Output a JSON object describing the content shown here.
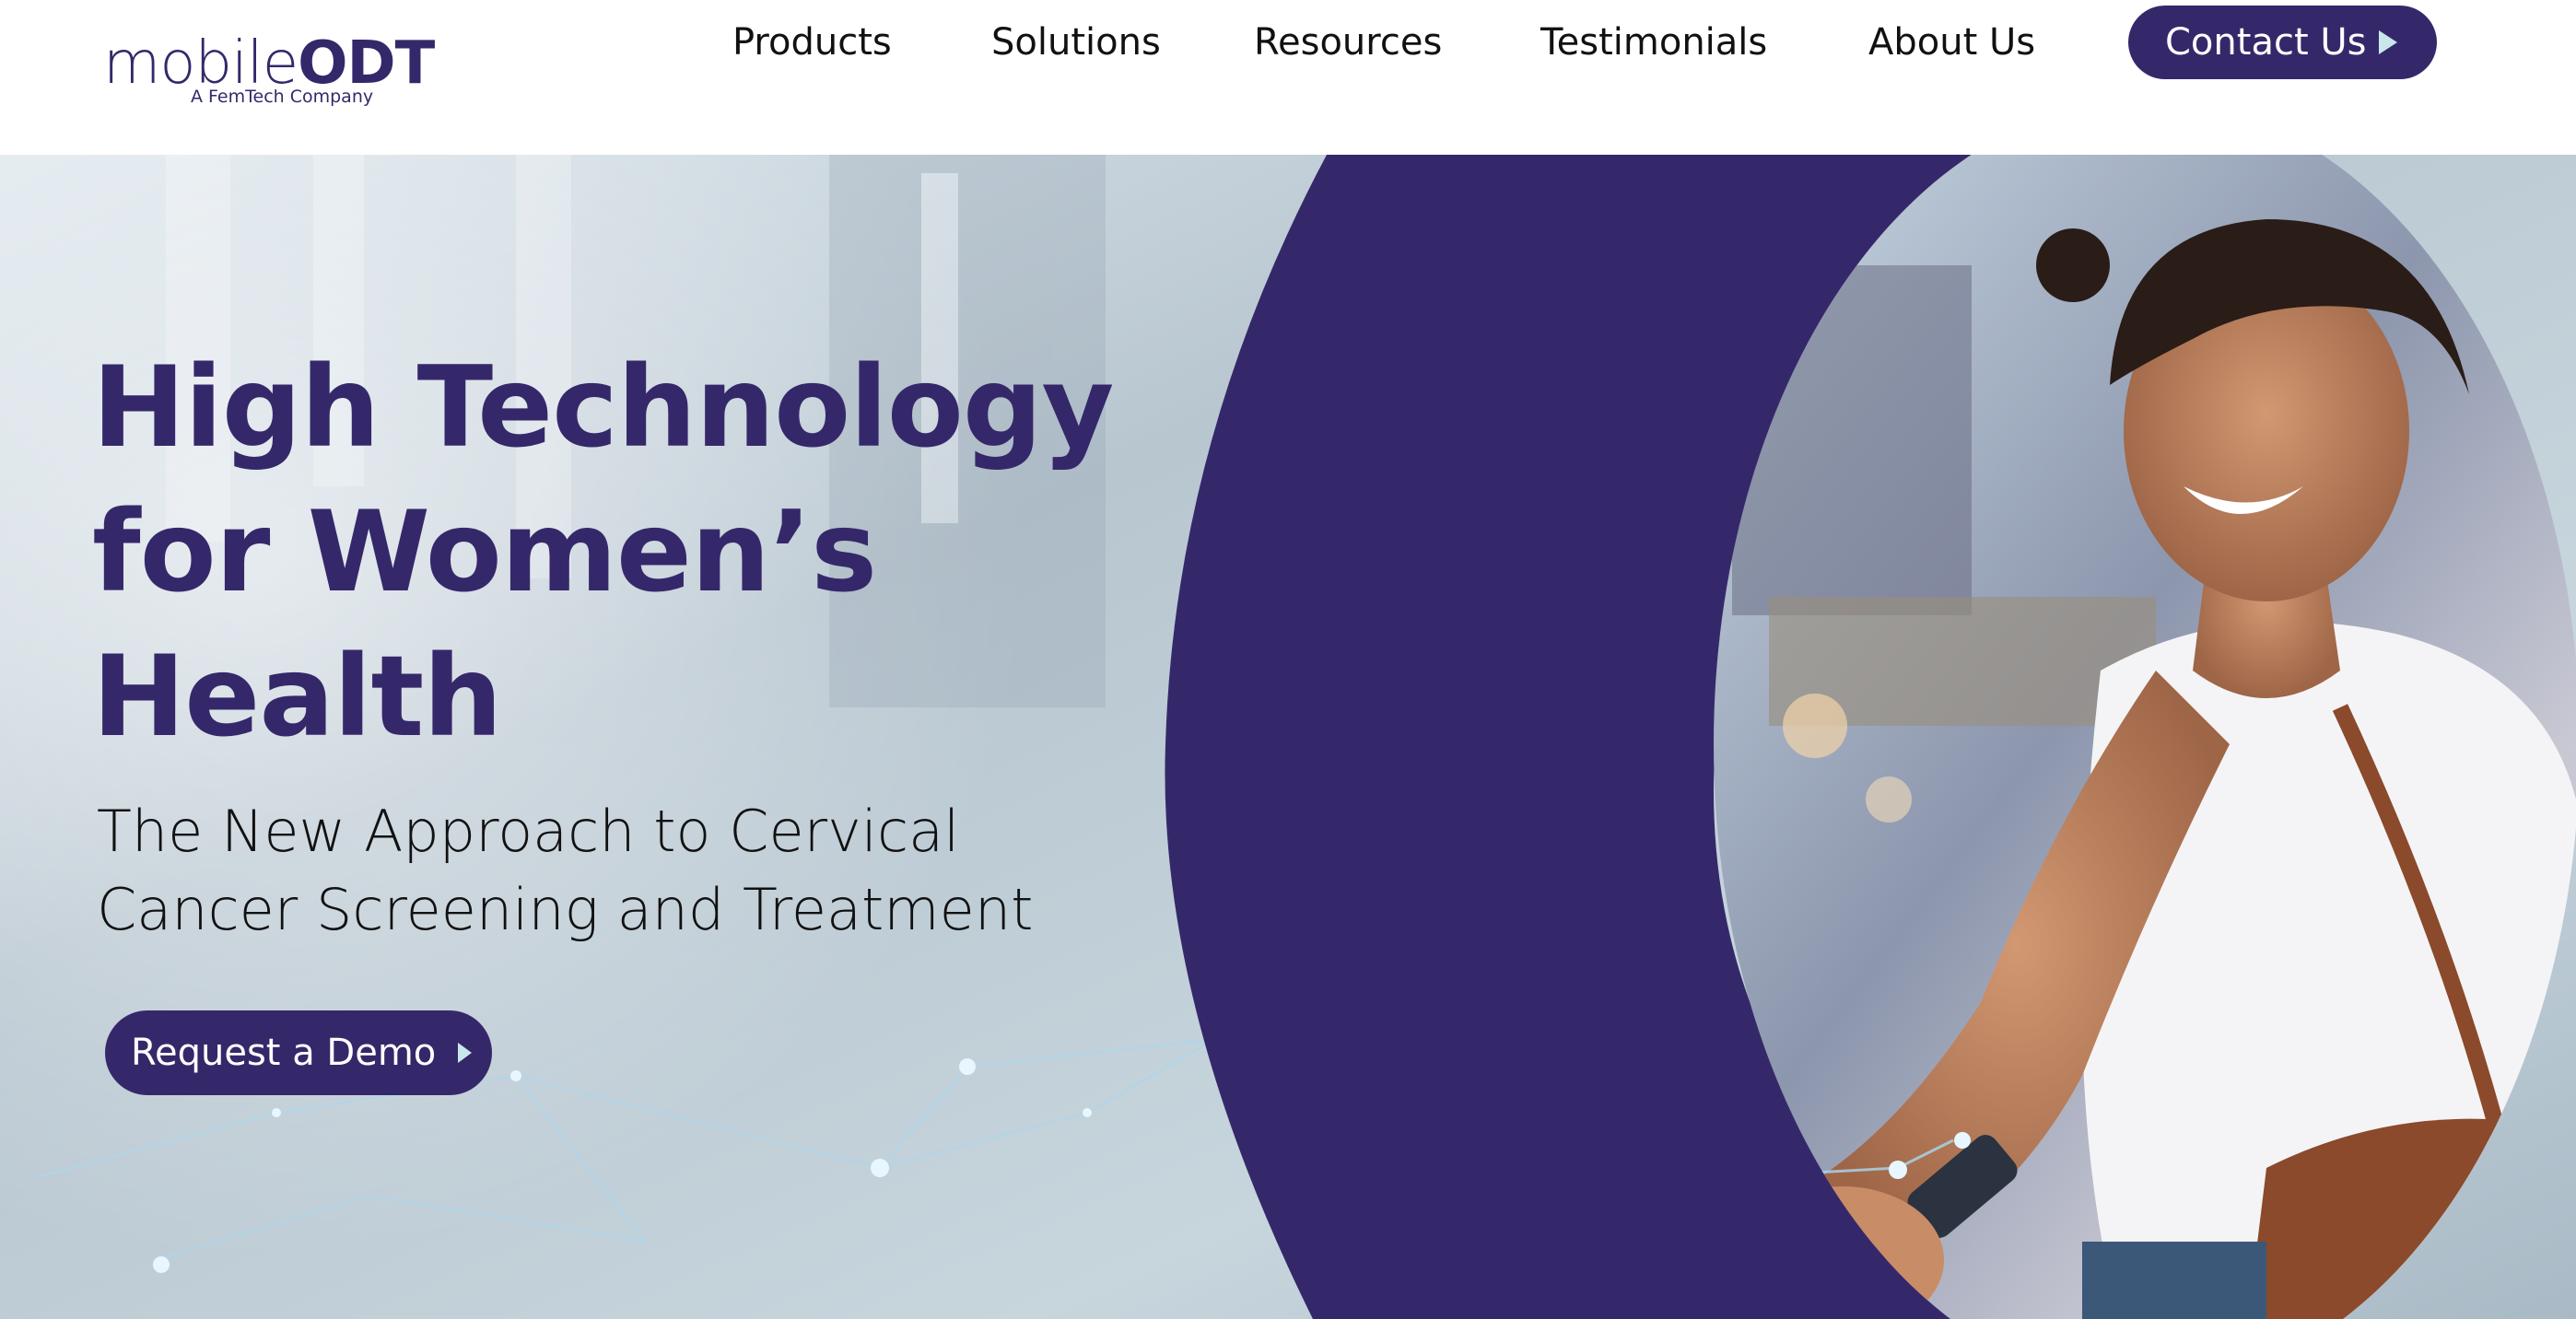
{
  "brand": {
    "name_light": "mobile",
    "name_bold": "ODT",
    "tagline": "A FemTech Company"
  },
  "nav": {
    "items": [
      {
        "label": "Products"
      },
      {
        "label": "Solutions"
      },
      {
        "label": "Resources"
      },
      {
        "label": "Testimonials"
      },
      {
        "label": "About Us"
      }
    ],
    "contact_label": "Contact Us"
  },
  "hero": {
    "title_lines": [
      "High Technology",
      "for Women’s",
      "Health"
    ],
    "subtitle_lines": [
      "The New Approach to Cervical",
      "Cancer Screening and Treatment"
    ],
    "cta_label": "Request a Demo"
  },
  "colors": {
    "brand_purple": "#35286a",
    "accent_teal": "#c9e7ea",
    "text_dark": "#111111"
  },
  "icons": {
    "contact_arrow": "play-triangle-icon",
    "cta_arrow": "play-triangle-icon",
    "brand_mark": "logo-icon"
  }
}
